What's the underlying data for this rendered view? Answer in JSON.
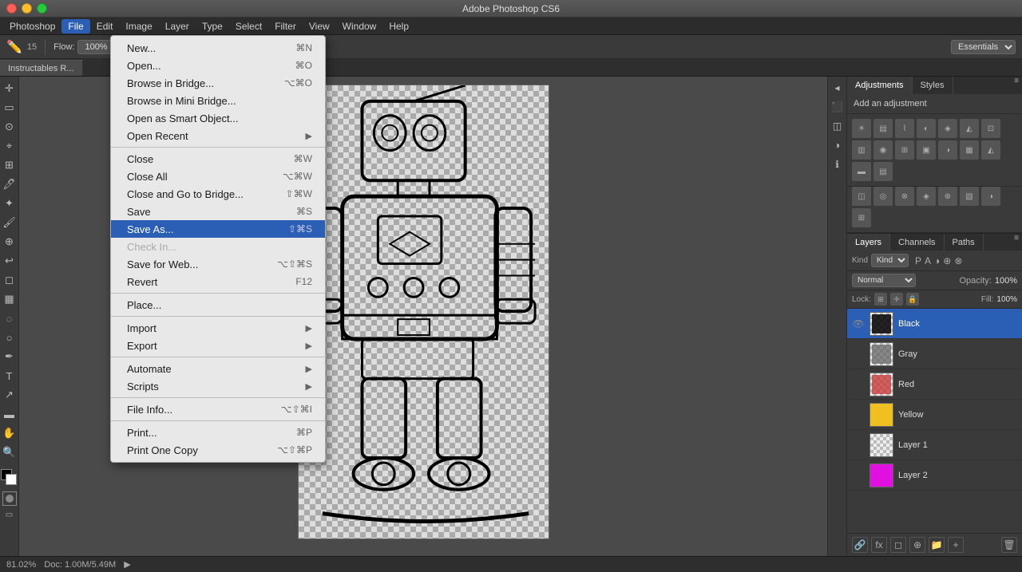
{
  "window": {
    "title": "Adobe Photoshop CS6",
    "controls": [
      "close",
      "minimize",
      "maximize"
    ]
  },
  "menubar": {
    "items": [
      "Photoshop",
      "File",
      "Edit",
      "Image",
      "Layer",
      "Type",
      "Select",
      "Filter",
      "View",
      "Window",
      "Help"
    ],
    "active": "File"
  },
  "toolbar": {
    "flow_label": "Flow:",
    "flow_value": "100%",
    "workspace": "Essentials"
  },
  "tabbar": {
    "active_tab": "Instructables R..."
  },
  "dropdown": {
    "items": [
      {
        "label": "New...",
        "shortcut": "⌘N",
        "type": "item"
      },
      {
        "label": "Open...",
        "shortcut": "⌘O",
        "type": "item"
      },
      {
        "label": "Browse in Bridge...",
        "shortcut": "⌥⌘O",
        "type": "item"
      },
      {
        "label": "Browse in Mini Bridge...",
        "shortcut": "",
        "type": "item"
      },
      {
        "label": "Open as Smart Object...",
        "shortcut": "",
        "type": "item"
      },
      {
        "label": "Open Recent",
        "shortcut": "",
        "type": "submenu"
      },
      {
        "type": "divider"
      },
      {
        "label": "Close",
        "shortcut": "⌘W",
        "type": "item"
      },
      {
        "label": "Close All",
        "shortcut": "⌥⌘W",
        "type": "item"
      },
      {
        "label": "Close and Go to Bridge...",
        "shortcut": "⇧⌘W",
        "type": "item"
      },
      {
        "label": "Save",
        "shortcut": "⌘S",
        "type": "item"
      },
      {
        "label": "Save As...",
        "shortcut": "⇧⌘S",
        "type": "highlighted"
      },
      {
        "label": "Check In...",
        "shortcut": "",
        "type": "disabled"
      },
      {
        "label": "Save for Web...",
        "shortcut": "⌥⇧⌘S",
        "type": "item"
      },
      {
        "label": "Revert",
        "shortcut": "F12",
        "type": "item"
      },
      {
        "type": "divider"
      },
      {
        "label": "Place...",
        "shortcut": "",
        "type": "item"
      },
      {
        "type": "divider"
      },
      {
        "label": "Import",
        "shortcut": "",
        "type": "submenu"
      },
      {
        "label": "Export",
        "shortcut": "",
        "type": "submenu"
      },
      {
        "type": "divider"
      },
      {
        "label": "Automate",
        "shortcut": "",
        "type": "submenu"
      },
      {
        "label": "Scripts",
        "shortcut": "",
        "type": "submenu"
      },
      {
        "type": "divider"
      },
      {
        "label": "File Info...",
        "shortcut": "⌥⇧⌘I",
        "type": "item"
      },
      {
        "type": "divider"
      },
      {
        "label": "Print...",
        "shortcut": "⌘P",
        "type": "item"
      },
      {
        "label": "Print One Copy",
        "shortcut": "⌥⇧⌘P",
        "type": "item"
      }
    ]
  },
  "layers_panel": {
    "tabs": [
      "Layers",
      "Channels",
      "Paths"
    ],
    "active_tab": "Layers",
    "kind_label": "Kind",
    "blend_mode": "Normal",
    "opacity_label": "Opacity:",
    "opacity_value": "100%",
    "lock_label": "Lock:",
    "fill_label": "Fill:",
    "fill_value": "100%",
    "layers": [
      {
        "name": "Black",
        "visible": true,
        "selected": true,
        "thumb": "black"
      },
      {
        "name": "Gray",
        "visible": false,
        "selected": false,
        "thumb": "gray"
      },
      {
        "name": "Red",
        "visible": false,
        "selected": false,
        "thumb": "red"
      },
      {
        "name": "Yellow",
        "visible": false,
        "selected": false,
        "thumb": "yellow"
      },
      {
        "name": "Layer 1",
        "visible": false,
        "selected": false,
        "thumb": "layer1"
      },
      {
        "name": "Layer 2",
        "visible": false,
        "selected": false,
        "thumb": "layer2"
      }
    ]
  },
  "adjustments_panel": {
    "tabs": [
      "Adjustments",
      "Styles"
    ],
    "active_tab": "Adjustments",
    "header": "Add an adjustment"
  },
  "statusbar": {
    "zoom": "81.02%",
    "doc_info": "Doc: 1.00M/5.49M"
  },
  "tools": [
    "move",
    "marquee",
    "lasso",
    "quick-select",
    "crop",
    "eyedropper",
    "healing-brush",
    "brush",
    "clone-stamp",
    "history-brush",
    "eraser",
    "gradient",
    "blur",
    "dodge",
    "pen",
    "type",
    "path-select",
    "shape",
    "hand",
    "zoom"
  ]
}
